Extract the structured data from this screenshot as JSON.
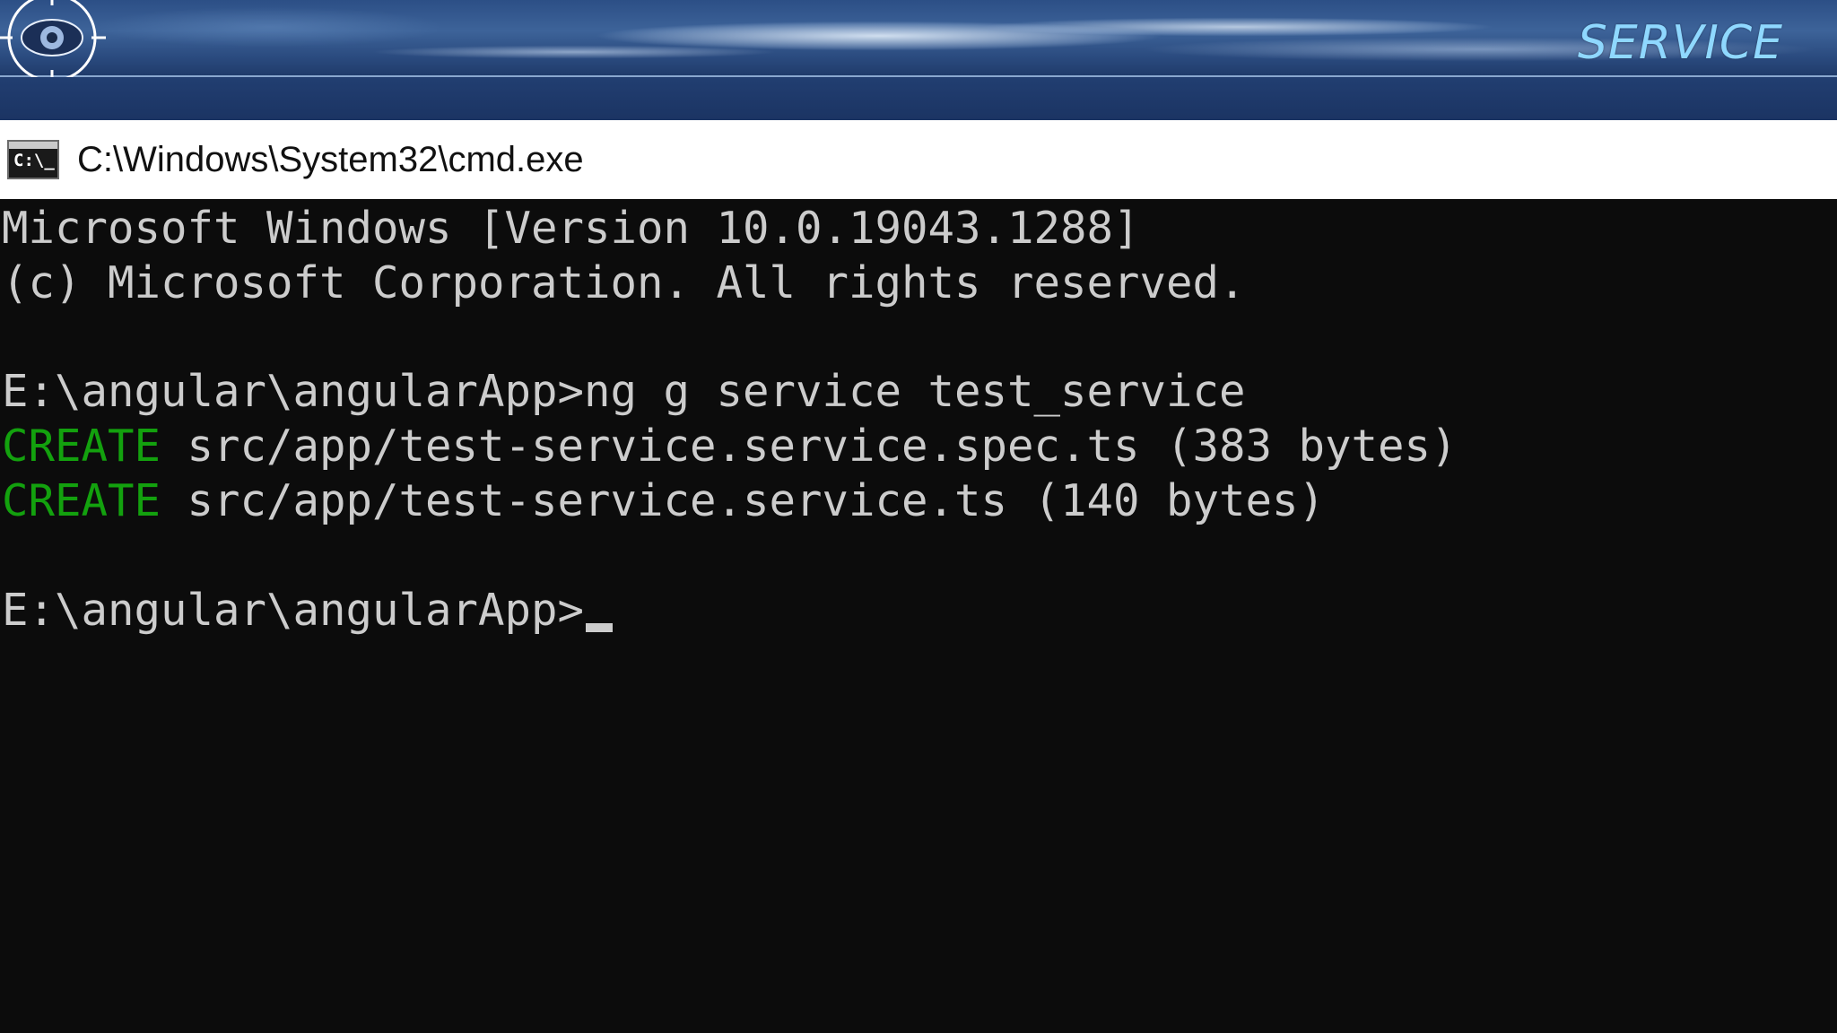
{
  "slide": {
    "title": "SERVICE",
    "title_color": "#8fd8ff",
    "logo_icon": "eye-target-icon"
  },
  "window": {
    "title": "C:\\Windows\\System32\\cmd.exe",
    "icon": "cmd-icon",
    "icon_text": "C:\\_"
  },
  "console": {
    "banner_line_1": "Microsoft Windows [Version 10.0.19043.1288]",
    "banner_line_2": "(c) Microsoft Corporation. All rights reserved.",
    "command_prompt": "E:\\angular\\angularApp>",
    "command": "ng g service test_service",
    "outputs": [
      {
        "tag": "CREATE",
        "text": " src/app/test-service.service.spec.ts (383 bytes)"
      },
      {
        "tag": "CREATE",
        "text": " src/app/test-service.service.ts (140 bytes)"
      }
    ],
    "final_prompt": "E:\\angular\\angularApp>",
    "text_color": "#cccccc",
    "create_color": "#13a10e",
    "background": "#0c0c0c"
  }
}
